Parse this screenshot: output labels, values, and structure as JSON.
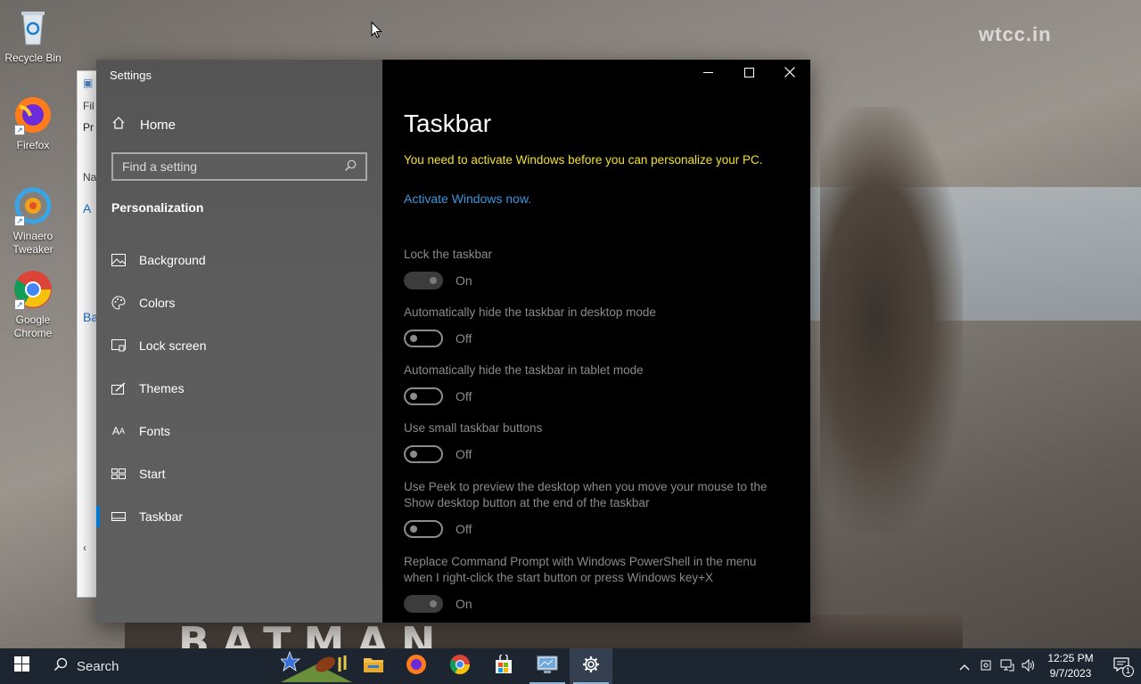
{
  "desktop": {
    "watermark": "wtcc.in",
    "wallpaper_text": "BATMAN",
    "icons": [
      {
        "label": "Recycle Bin",
        "icon": "recycle-bin-icon"
      },
      {
        "label": "Firefox",
        "icon": "firefox-icon"
      },
      {
        "label": "Winaero Tweaker",
        "icon": "winaero-tweaker-icon"
      },
      {
        "label": "Google Chrome",
        "icon": "chrome-icon"
      }
    ]
  },
  "explorer_fragment": {
    "items": [
      "Fil",
      "Pr",
      "Na",
      "A",
      "Ba"
    ]
  },
  "window": {
    "title": "Settings",
    "controls": {
      "minimize": "minimize-icon",
      "maximize": "maximize-icon",
      "close": "close-icon"
    }
  },
  "sidebar": {
    "home_label": "Home",
    "search_placeholder": "Find a setting",
    "section_title": "Personalization",
    "items": [
      {
        "label": "Background",
        "icon": "picture-icon"
      },
      {
        "label": "Colors",
        "icon": "palette-icon"
      },
      {
        "label": "Lock screen",
        "icon": "lock-screen-icon"
      },
      {
        "label": "Themes",
        "icon": "themes-icon"
      },
      {
        "label": "Fonts",
        "icon": "fonts-icon"
      },
      {
        "label": "Start",
        "icon": "start-icon"
      },
      {
        "label": "Taskbar",
        "icon": "taskbar-icon",
        "active": true
      }
    ]
  },
  "main": {
    "title": "Taskbar",
    "warning": "You need to activate Windows before you can personalize your PC.",
    "activate_link": "Activate Windows now.",
    "settings": [
      {
        "label": "Lock the taskbar",
        "state": "On",
        "on": true
      },
      {
        "label": "Automatically hide the taskbar in desktop mode",
        "state": "Off",
        "on": false
      },
      {
        "label": "Automatically hide the taskbar in tablet mode",
        "state": "Off",
        "on": false
      },
      {
        "label": "Use small taskbar buttons",
        "state": "Off",
        "on": false
      },
      {
        "label": "Use Peek to preview the desktop when you move your mouse to the Show desktop button at the end of the taskbar",
        "state": "Off",
        "on": false
      },
      {
        "label": "Replace Command Prompt with Windows PowerShell in the menu when I right-click the start button or press Windows key+X",
        "state": "On",
        "on": true
      }
    ]
  },
  "taskbar": {
    "search_label": "Search",
    "apps": [
      "file-explorer-icon",
      "firefox-icon",
      "chrome-icon",
      "store-icon",
      "control-panel-icon",
      "settings-gear-icon"
    ],
    "time": "12:25 PM",
    "date": "9/7/2023",
    "notification_count": "1"
  },
  "colors": {
    "accent": "#0078d4",
    "warning": "#f2e22b",
    "link": "#3a96dd",
    "taskbar": "#1d2530"
  }
}
